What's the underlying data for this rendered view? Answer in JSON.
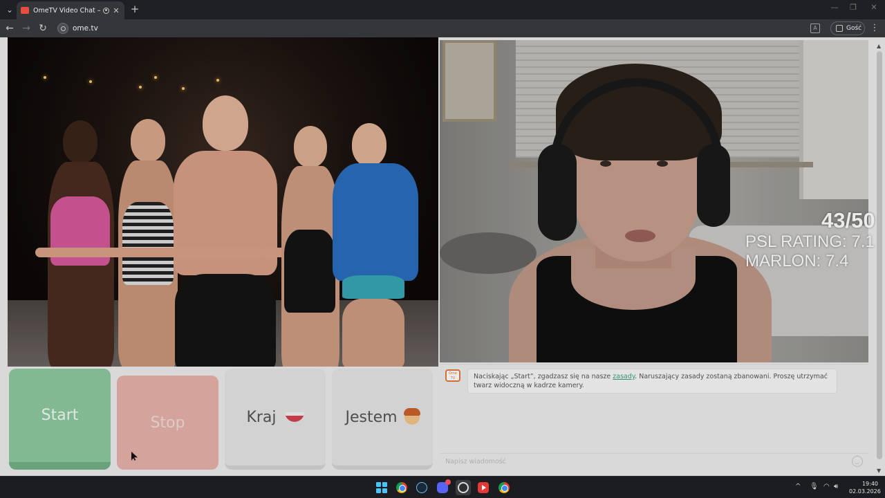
{
  "browser": {
    "tab_title": "OmeTV Video Chat — Ome",
    "url": "ome.tv",
    "profile_label": "Gość"
  },
  "video": {
    "overlay": {
      "score": "43/50",
      "psl_rating": "PSL RATING: 7.1",
      "marlon": "MARLON: 7.4"
    }
  },
  "controls": {
    "start_label": "Start",
    "stop_label": "Stop",
    "country_label": "Kraj",
    "gender_label": "Jestem"
  },
  "chat": {
    "logo_text": "Ome TV",
    "message_before_link": "Naciskając „Start”, zgadzasz się na nasze ",
    "link_text": "zasady",
    "message_after_link": ". Naruszający zasady zostaną zbanowani. Proszę utrzymać twarz widoczną w kadrze kamery.",
    "input_placeholder": "Napisz wiadomość"
  },
  "taskbar": {
    "time": "19:40",
    "date": "02.03.2026",
    "discord_badge": "1"
  },
  "colors": {
    "start_button": "#8ec9a0",
    "stop_button": "#e7b1a9",
    "link": "#3aa07a"
  }
}
